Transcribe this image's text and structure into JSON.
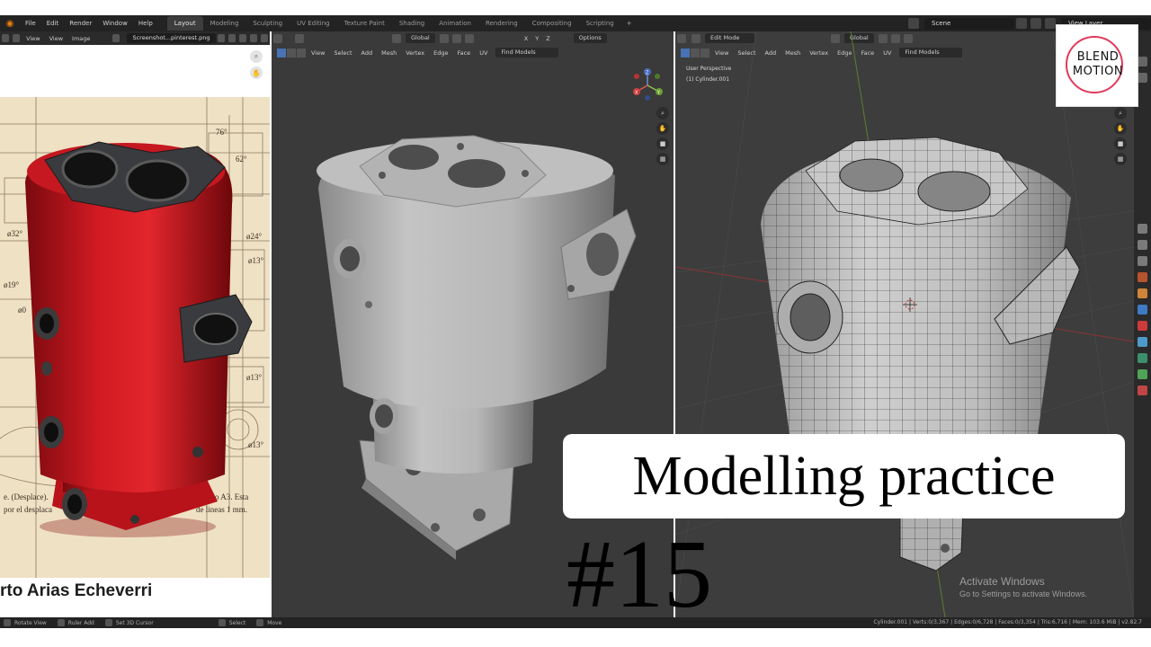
{
  "app": {
    "menus": [
      "File",
      "Edit",
      "Render",
      "Window",
      "Help"
    ],
    "workspaces": [
      "Layout",
      "Modeling",
      "Sculpting",
      "UV Editing",
      "Texture Paint",
      "Shading",
      "Animation",
      "Rendering",
      "Compositing",
      "Scripting"
    ],
    "active_workspace": "Layout",
    "scene": "Scene",
    "view_layer": "View Layer"
  },
  "image_editor": {
    "menus": [
      "View",
      "View",
      "Image"
    ],
    "image_name": "Screenshot...pinterest.png",
    "author_text": "rto Arias Echeverri",
    "blueprint_labels": [
      "76°",
      "62°",
      "ø32°",
      "ø24°",
      "ø13°",
      "ø19°",
      "ø13°",
      "ø13°",
      "ø0"
    ],
    "blueprint_caption_1": "e. (Desplace).",
    "blueprint_caption_2": "por el desplaca",
    "blueprint_caption_3": "ormato A3. Esta",
    "blueprint_caption_4": "de lineas 1 mm."
  },
  "viewport_solid": {
    "orientation": "Global",
    "options_label": "Options",
    "menus": [
      "View",
      "Select",
      "Add",
      "Mesh",
      "Vertex",
      "Edge",
      "Face",
      "UV"
    ],
    "find_label": "Find Models",
    "axis_labels": [
      "X",
      "Y",
      "Z"
    ],
    "gizmo_labels": [
      "Z",
      "Y",
      "X"
    ]
  },
  "viewport_edit": {
    "mode": "Edit Mode",
    "orientation": "Global",
    "menus": [
      "View",
      "Select",
      "Add",
      "Mesh",
      "Vertex",
      "Edge",
      "Face",
      "UV"
    ],
    "find_label": "Find Models",
    "perspective_label": "User Perspective",
    "object_label": "(1) Cylinder.001",
    "activate_title": "Activate Windows",
    "activate_sub": "Go to Settings to activate Windows."
  },
  "statusbar": {
    "items": [
      "Rotate View",
      "Ruler Add",
      "Set 3D Cursor",
      "Select",
      "Move"
    ],
    "stats": "Cylinder.001 | Verts:0/3,367 | Edges:0/6,728 | Faces:0/3,354 | Tris:6,716 | Mem: 103.6 MiB | v2.82.7"
  },
  "brand": {
    "line1": "BLEND",
    "line2": "MOTION"
  },
  "title": {
    "text": "Modelling practice",
    "number": "#15"
  },
  "colors": {
    "accent_red": "#c2141e",
    "blender_orange": "#e87d0d",
    "brand_circle": "#e03a5a",
    "active_blue": "#4772b3"
  }
}
